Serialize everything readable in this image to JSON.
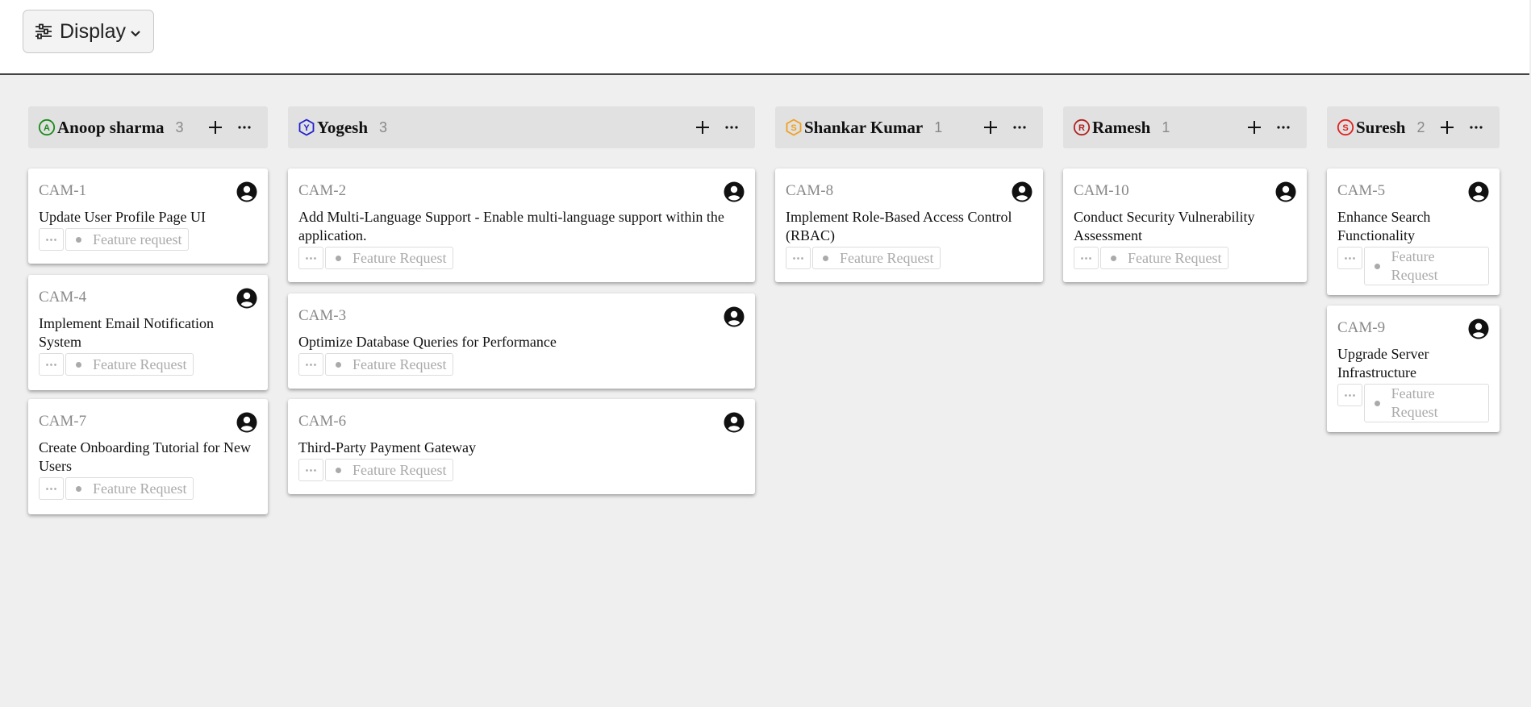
{
  "toolbar": {
    "display_label": "Display",
    "display_icon": "sliders-icon",
    "dropdown_icon": "chevron-down-icon"
  },
  "columns": [
    {
      "name": "Anoop sharma",
      "count": "3",
      "initial": "A",
      "color": "#1a8a1a",
      "icon": "circle",
      "cards": [
        {
          "id": "CAM-1",
          "title": "Update User Profile Page UI",
          "label": "Feature request"
        },
        {
          "id": "CAM-4",
          "title": "Implement Email Notification System",
          "label": "Feature Request"
        },
        {
          "id": "CAM-7",
          "title": "Create Onboarding Tutorial for New Users",
          "label": "Feature Request"
        }
      ]
    },
    {
      "name": "Yogesh",
      "count": "3",
      "initial": "Y",
      "color": "#2020d0",
      "icon": "hexagon",
      "cards": [
        {
          "id": "CAM-2",
          "title": "Add Multi-Language Support - Enable multi-language support within the application.",
          "label": "Feature Request"
        },
        {
          "id": "CAM-3",
          "title": "Optimize Database Queries for Performance",
          "label": "Feature Request"
        },
        {
          "id": "CAM-6",
          "title": "Third-Party Payment Gateway",
          "label": "Feature Request"
        }
      ]
    },
    {
      "name": "Shankar Kumar",
      "count": "1",
      "initial": "S",
      "color": "#f0a020",
      "icon": "hexagon",
      "cards": [
        {
          "id": "CAM-8",
          "title": "Implement Role-Based Access Control (RBAC)",
          "label": "Feature Request"
        }
      ]
    },
    {
      "name": "Ramesh",
      "count": "1",
      "initial": "R",
      "color": "#b02020",
      "icon": "circle",
      "cards": [
        {
          "id": "CAM-10",
          "title": "Conduct Security Vulnerability Assessment",
          "label": "Feature Request"
        }
      ]
    },
    {
      "name": "Suresh",
      "count": "2",
      "initial": "S",
      "color": "#e02020",
      "icon": "circle",
      "cards": [
        {
          "id": "CAM-5",
          "title": "Enhance Search Functionality",
          "label": "Feature Request"
        },
        {
          "id": "CAM-9",
          "title": "Upgrade Server Infrastructure",
          "label": "Feature Request"
        }
      ]
    }
  ],
  "icons": {
    "add": "plus-icon",
    "more": "ellipsis-icon",
    "assignee": "user-circle-icon"
  }
}
